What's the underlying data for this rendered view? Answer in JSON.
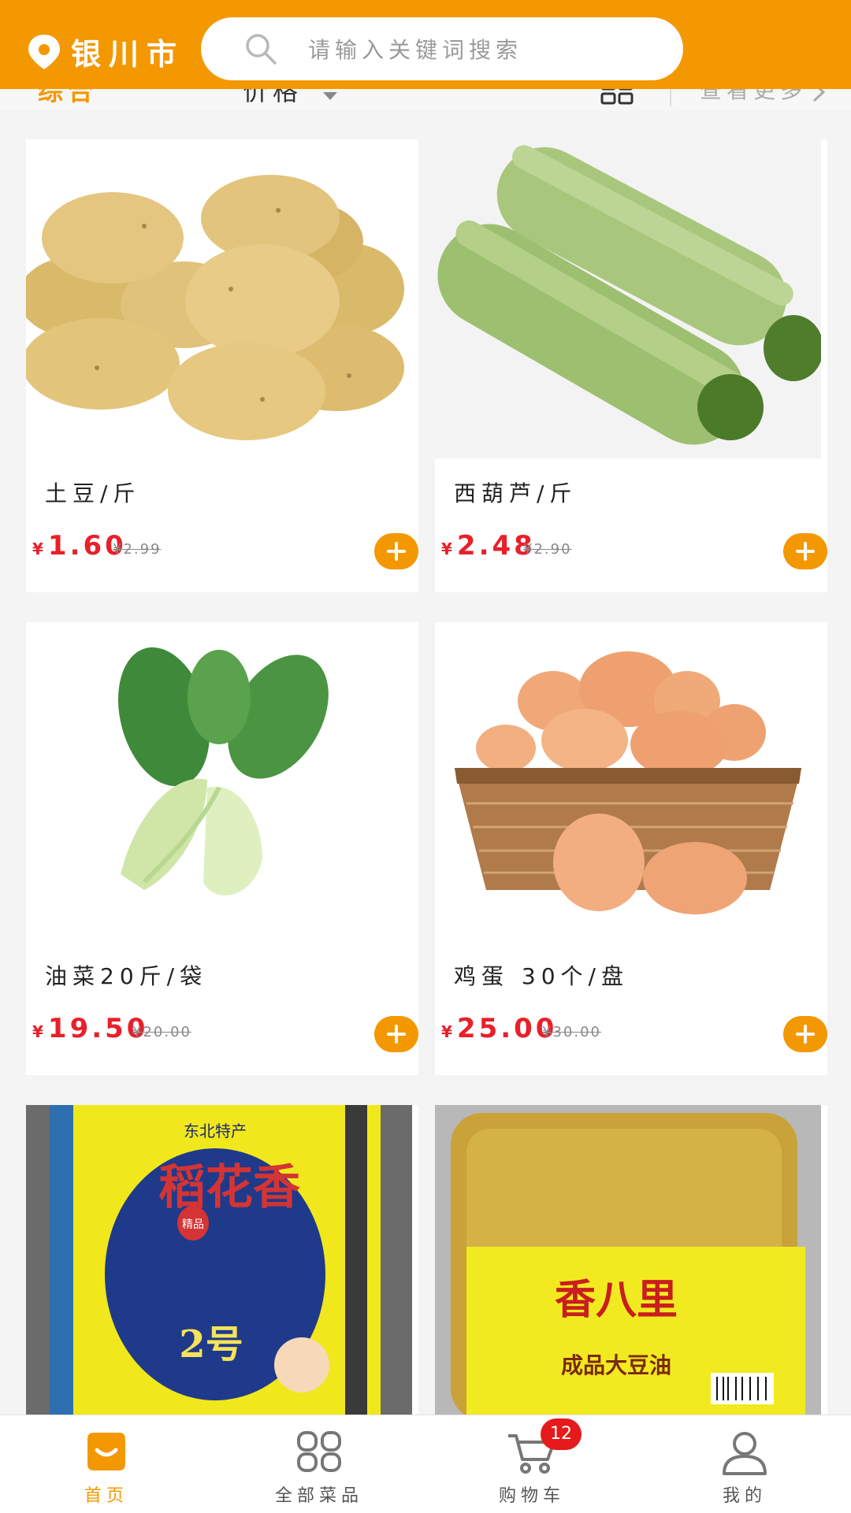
{
  "header": {
    "city": "银川市",
    "search_placeholder": "请输入关键词搜索"
  },
  "sort_bar": {
    "comprehensive": "综合",
    "price": "价格",
    "more": "查看更多"
  },
  "products": [
    {
      "name": "土豆/斤",
      "currency": "¥",
      "price": "1.60",
      "old_price": "¥2.99"
    },
    {
      "name": "西葫芦/斤",
      "currency": "¥",
      "price": "2.48",
      "old_price": "¥2.90"
    },
    {
      "name": "油菜20斤/袋",
      "currency": "¥",
      "price": "19.50",
      "old_price": "¥20.00"
    },
    {
      "name": "鸡蛋 30个/盘",
      "currency": "¥",
      "price": "25.00",
      "old_price": "¥30.00"
    },
    {
      "image_text": [
        "东北特产",
        "稻花香",
        "2号",
        "精品"
      ]
    },
    {
      "image_text": [
        "香八里",
        "成品大豆油"
      ]
    }
  ],
  "tabbar": {
    "tabs": [
      {
        "label": "首页",
        "active": true
      },
      {
        "label": "全部菜品",
        "active": false
      },
      {
        "label": "购物车",
        "active": false,
        "badge": "12"
      },
      {
        "label": "我的",
        "active": false
      }
    ]
  },
  "colors": {
    "accent": "#f39800",
    "price": "#e8202a",
    "badge": "#e61a1a"
  }
}
